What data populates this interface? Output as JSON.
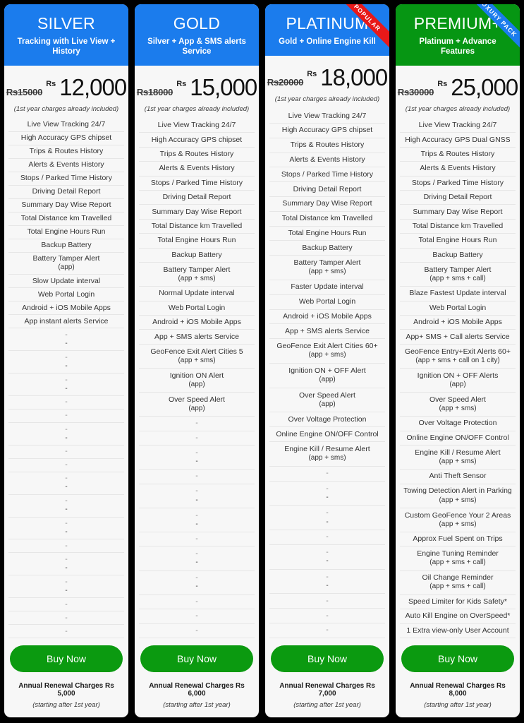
{
  "colors": {
    "header_blue": "#1b7ced",
    "header_green": "#069613",
    "buy_green": "#0b9a10",
    "ribbon_red": "#e81919",
    "ribbon_blue": "#1b7ced",
    "card_bg": "#f7f7f7",
    "page_bg": "#000000"
  },
  "price_note": "(1st year charges already included)",
  "currency_symbol": "Rs",
  "buy_label": "Buy Now",
  "renewal_note": "(starting after 1st year)",
  "plans": [
    {
      "name": "SILVER",
      "subtitle": "Tracking with Live View + History",
      "header_color": "blue",
      "ribbon": null,
      "old_price": "Rs15000",
      "price": "12,000",
      "renewal": "Annual Renewal Charges Rs 5,000",
      "features": [
        {
          "main": "Live View Tracking 24/7",
          "sub": ""
        },
        {
          "main": "High Accuracy GPS chipset",
          "sub": ""
        },
        {
          "main": "Trips & Routes History",
          "sub": ""
        },
        {
          "main": "Alerts & Events History",
          "sub": ""
        },
        {
          "main": "Stops / Parked Time History",
          "sub": ""
        },
        {
          "main": "Driving Detail Report",
          "sub": ""
        },
        {
          "main": "Summary Day Wise Report",
          "sub": ""
        },
        {
          "main": "Total Distance km Travelled",
          "sub": ""
        },
        {
          "main": "Total Engine Hours Run",
          "sub": ""
        },
        {
          "main": "Backup Battery",
          "sub": ""
        },
        {
          "main": "Battery Tamper Alert",
          "sub": "(app)"
        },
        {
          "main": "Slow Update interval",
          "sub": ""
        },
        {
          "main": "Web Portal Login",
          "sub": ""
        },
        {
          "main": "Android + iOS Mobile Apps",
          "sub": ""
        },
        {
          "main": "App instant alerts Service",
          "sub": ""
        },
        {
          "main": "-",
          "sub": "-"
        },
        {
          "main": "-",
          "sub": "-"
        },
        {
          "main": "-",
          "sub": "-"
        },
        {
          "main": "-",
          "sub": ""
        },
        {
          "main": "-",
          "sub": ""
        },
        {
          "main": "-",
          "sub": "-"
        },
        {
          "main": "-",
          "sub": ""
        },
        {
          "main": "-",
          "sub": ""
        },
        {
          "main": "-",
          "sub": "-"
        },
        {
          "main": "-",
          "sub": "-"
        },
        {
          "main": "-",
          "sub": "-"
        },
        {
          "main": "-",
          "sub": ""
        },
        {
          "main": "-",
          "sub": "-"
        },
        {
          "main": "-",
          "sub": "-"
        },
        {
          "main": "-",
          "sub": ""
        },
        {
          "main": "-",
          "sub": ""
        },
        {
          "main": "-",
          "sub": ""
        }
      ]
    },
    {
      "name": "GOLD",
      "subtitle": "Silver + App & SMS alerts Service",
      "header_color": "blue",
      "ribbon": null,
      "old_price": "Rs18000",
      "price": "15,000",
      "renewal": "Annual Renewal Charges Rs 6,000",
      "features": [
        {
          "main": "Live View Tracking 24/7",
          "sub": ""
        },
        {
          "main": "High Accuracy GPS chipset",
          "sub": ""
        },
        {
          "main": "Trips & Routes History",
          "sub": ""
        },
        {
          "main": "Alerts & Events History",
          "sub": ""
        },
        {
          "main": "Stops / Parked Time History",
          "sub": ""
        },
        {
          "main": "Driving Detail Report",
          "sub": ""
        },
        {
          "main": "Summary Day Wise Report",
          "sub": ""
        },
        {
          "main": "Total Distance km Travelled",
          "sub": ""
        },
        {
          "main": "Total Engine Hours Run",
          "sub": ""
        },
        {
          "main": "Backup Battery",
          "sub": ""
        },
        {
          "main": "Battery Tamper Alert",
          "sub": "(app + sms)"
        },
        {
          "main": "Normal Update interval",
          "sub": ""
        },
        {
          "main": "Web Portal Login",
          "sub": ""
        },
        {
          "main": "Android + iOS Mobile Apps",
          "sub": ""
        },
        {
          "main": "App + SMS alerts Service",
          "sub": ""
        },
        {
          "main": "GeoFence Exit Alert Cities 5",
          "sub": "(app + sms)"
        },
        {
          "main": "Ignition ON Alert",
          "sub": "(app)"
        },
        {
          "main": "Over Speed Alert",
          "sub": "(app)"
        },
        {
          "main": "-",
          "sub": ""
        },
        {
          "main": "-",
          "sub": ""
        },
        {
          "main": "-",
          "sub": "-"
        },
        {
          "main": "-",
          "sub": ""
        },
        {
          "main": "-",
          "sub": "-"
        },
        {
          "main": "-",
          "sub": "-"
        },
        {
          "main": "-",
          "sub": ""
        },
        {
          "main": "-",
          "sub": "-"
        },
        {
          "main": "-",
          "sub": "-"
        },
        {
          "main": "-",
          "sub": ""
        },
        {
          "main": "-",
          "sub": ""
        },
        {
          "main": "-",
          "sub": ""
        }
      ]
    },
    {
      "name": "PLATINUM",
      "subtitle": "Gold + Online Engine Kill",
      "header_color": "blue",
      "ribbon": {
        "text": "POPULAR",
        "color": "red"
      },
      "old_price": "Rs20000",
      "price": "18,000",
      "renewal": "Annual Renewal Charges Rs 7,000",
      "features": [
        {
          "main": "Live View Tracking 24/7",
          "sub": ""
        },
        {
          "main": "High Accuracy GPS chipset",
          "sub": ""
        },
        {
          "main": "Trips & Routes History",
          "sub": ""
        },
        {
          "main": "Alerts & Events History",
          "sub": ""
        },
        {
          "main": "Stops / Parked Time History",
          "sub": ""
        },
        {
          "main": "Driving Detail Report",
          "sub": ""
        },
        {
          "main": "Summary Day Wise Report",
          "sub": ""
        },
        {
          "main": "Total Distance km Travelled",
          "sub": ""
        },
        {
          "main": "Total Engine Hours Run",
          "sub": ""
        },
        {
          "main": "Backup Battery",
          "sub": ""
        },
        {
          "main": "Battery Tamper Alert",
          "sub": "(app + sms)"
        },
        {
          "main": "Faster Update interval",
          "sub": ""
        },
        {
          "main": "Web Portal Login",
          "sub": ""
        },
        {
          "main": "Android + iOS Mobile Apps",
          "sub": ""
        },
        {
          "main": "App + SMS alerts Service",
          "sub": ""
        },
        {
          "main": "GeoFence Exit Alert Cities 60+",
          "sub": "(app + sms)"
        },
        {
          "main": "Ignition ON + OFF Alert",
          "sub": "(app)"
        },
        {
          "main": "Over Speed Alert",
          "sub": "(app)"
        },
        {
          "main": "Over Voltage Protection",
          "sub": ""
        },
        {
          "main": "Online Engine ON/OFF Control",
          "sub": ""
        },
        {
          "main": "Engine Kill / Resume Alert",
          "sub": "(app + sms)"
        },
        {
          "main": "-",
          "sub": ""
        },
        {
          "main": "-",
          "sub": "-"
        },
        {
          "main": "-",
          "sub": "-"
        },
        {
          "main": "-",
          "sub": ""
        },
        {
          "main": "-",
          "sub": "-"
        },
        {
          "main": "-",
          "sub": "-"
        },
        {
          "main": "-",
          "sub": ""
        },
        {
          "main": "-",
          "sub": ""
        },
        {
          "main": "-",
          "sub": ""
        }
      ]
    },
    {
      "name": "PREMIUM+",
      "subtitle": "Platinum + Advance Features",
      "header_color": "green",
      "ribbon": {
        "text": "LUXURY PACK",
        "color": "blue"
      },
      "old_price": "Rs30000",
      "price": "25,000",
      "renewal": "Annual Renewal Charges Rs 8,000",
      "features": [
        {
          "main": "Live View Tracking 24/7",
          "sub": ""
        },
        {
          "main": "High Accuracy GPS Dual GNSS",
          "sub": ""
        },
        {
          "main": "Trips & Routes History",
          "sub": ""
        },
        {
          "main": "Alerts & Events History",
          "sub": ""
        },
        {
          "main": "Stops / Parked Time History",
          "sub": ""
        },
        {
          "main": "Driving Detail Report",
          "sub": ""
        },
        {
          "main": "Summary Day Wise Report",
          "sub": ""
        },
        {
          "main": "Total Distance km Travelled",
          "sub": ""
        },
        {
          "main": "Total Engine Hours Run",
          "sub": ""
        },
        {
          "main": "Backup Battery",
          "sub": ""
        },
        {
          "main": "Battery Tamper Alert",
          "sub": "(app + sms + call)"
        },
        {
          "main": "Blaze Fastest Update interval",
          "sub": ""
        },
        {
          "main": "Web Portal Login",
          "sub": ""
        },
        {
          "main": "Android + iOS Mobile Apps",
          "sub": ""
        },
        {
          "main": "App+ SMS + Call alerts Service",
          "sub": ""
        },
        {
          "main": "GeoFence Entry+Exit Alerts 60+",
          "sub": "(app + sms + call on 1 city)"
        },
        {
          "main": "Ignition ON + OFF Alerts",
          "sub": "(app)"
        },
        {
          "main": "Over Speed Alert",
          "sub": "(app + sms)"
        },
        {
          "main": "Over Voltage Protection",
          "sub": ""
        },
        {
          "main": "Online Engine ON/OFF Control",
          "sub": ""
        },
        {
          "main": "Engine Kill / Resume Alert",
          "sub": "(app + sms)"
        },
        {
          "main": "Anti Theft Sensor",
          "sub": ""
        },
        {
          "main": "Towing Detection Alert in Parking",
          "sub": "(app + sms)"
        },
        {
          "main": "Custom GeoFence Your 2 Areas",
          "sub": "(app + sms)"
        },
        {
          "main": "Approx Fuel Spent on Trips",
          "sub": ""
        },
        {
          "main": "Engine Tuning Reminder",
          "sub": "(app + sms + call)"
        },
        {
          "main": "Oil Change Reminder",
          "sub": "(app + sms + call)"
        },
        {
          "main": "Speed Limiter for Kids Safety*",
          "sub": ""
        },
        {
          "main": "Auto Kill Engine on OverSpeed*",
          "sub": ""
        },
        {
          "main": "1 Extra view-only User Account",
          "sub": ""
        }
      ]
    }
  ]
}
